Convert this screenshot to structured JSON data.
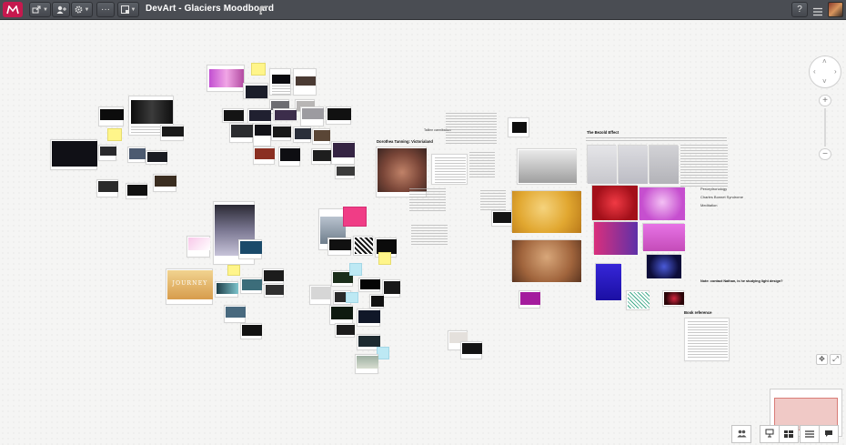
{
  "app": {
    "board_title": "DevArt - Glaciers Moodboard",
    "logo_icon": "milanote-logo-icon",
    "accent": "#c5194e"
  },
  "toolbar": {
    "share_icon": "share-icon",
    "user_icon": "add-user-icon",
    "settings_icon": "gear-icon",
    "more_label": "···",
    "frame_icon": "frame-icon",
    "sync_icon": "wifi-sync-icon",
    "help_label": "?",
    "menu_icon": "hamburger-menu-icon"
  },
  "board": {
    "bezold": {
      "heading": "The Bezold Effect",
      "list": [
        "Perceptronology",
        "Charles Bonnet Syndrome",
        "Meditation"
      ],
      "note": "Note: contact Nathan, is he studying light design?",
      "book_heading": "Book reference"
    },
    "dorothea": {
      "heading": "Dorothea Tanning: Victorialand",
      "label": "Tallinn cannibalism"
    },
    "journey": {
      "title": "JOURNEY"
    }
  },
  "navigation": {
    "up": "˄",
    "down": "˅",
    "left": "‹",
    "right": "›",
    "zoom_in": "+",
    "zoom_out": "−"
  }
}
